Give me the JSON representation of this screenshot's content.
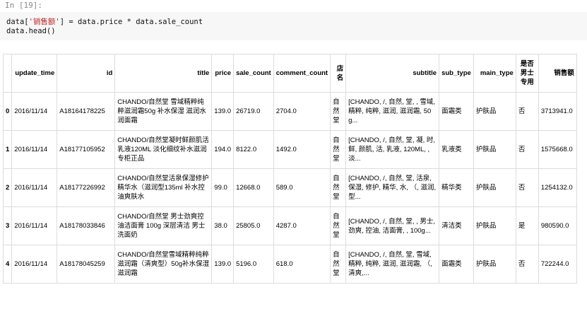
{
  "prompt": "In [19]:",
  "code": {
    "line1": {
      "prefix": "data[",
      "key": "'销售额'",
      "suffix": "] = data.price * data.sale_count"
    },
    "line2": "data.head()"
  },
  "table": {
    "columns": [
      "",
      "update_time",
      "id",
      "title",
      "price",
      "sale_count",
      "comment_count",
      "店名",
      "subtitle",
      "sub_type",
      "main_type",
      "是否男士专用",
      "销售额"
    ],
    "rows": [
      [
        "0",
        "2016/11/14",
        "A18164178225",
        "CHANDO/自然堂 雪域精粹纯粹滋润霜50g 补水保湿 滋润水润面霜",
        "139.0",
        "26719.0",
        "2704.0",
        "自然堂",
        "[CHANDO, /, 自然, 堂, , 雪域, 精粹, 纯粹, 滋润, 滋润霜, 50g...",
        "面霜类",
        "护肤品",
        "否",
        "3713941.0"
      ],
      [
        "1",
        "2016/11/14",
        "A18177105952",
        "CHANDO/自然堂凝时鲜颜肌活乳液120ML 淡化细纹补水滋润专柜正品",
        "194.0",
        "8122.0",
        "1492.0",
        "自然堂",
        "[CHANDO, /, 自然, 堂, 凝, 时, 鲜, 颜肌, 活, 乳液, 120ML, , 淡...",
        "乳液类",
        "护肤品",
        "否",
        "1575668.0"
      ],
      [
        "2",
        "2016/11/14",
        "A18177226992",
        "CHANDO/自然堂活泉保湿修护精华水（滋润型135ml 补水控油爽肤水",
        "99.0",
        "12668.0",
        "589.0",
        "自然堂",
        "[CHANDO, /, 自然, 堂, 活泉, 保湿, 修护, 精华, 水, （, 滋润, 型...",
        "精华类",
        "护肤品",
        "否",
        "1254132.0"
      ],
      [
        "3",
        "2016/11/14",
        "A18178033846",
        "CHANDO/自然堂 男士劲爽控油洁面膏 100g 深层清洁 男士洗面奶",
        "38.0",
        "25805.0",
        "4287.0",
        "自然堂",
        "[CHANDO, /, 自然, 堂, , 男士, 劲爽, 控油, 洁面膏, , 100g...",
        "清洁类",
        "护肤品",
        "是",
        "980590.0"
      ],
      [
        "4",
        "2016/11/14",
        "A18178045259",
        "CHANDO/自然堂雪域精粹纯粹滋润霜（清爽型）50g补水保湿滋润霜",
        "139.0",
        "5196.0",
        "618.0",
        "自然堂",
        "[CHANDO, /, 自然, 堂, 雪域, 精粹, 纯粹, 滋润, 滋润霜, （, 清爽,...",
        "面霜类",
        "护肤品",
        "否",
        "722244.0"
      ]
    ]
  }
}
